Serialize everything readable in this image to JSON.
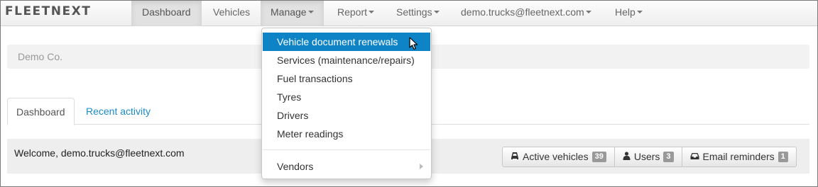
{
  "navbar": {
    "brand": "FLEETNEXT",
    "items": [
      {
        "label": "Dashboard"
      },
      {
        "label": "Vehicles"
      },
      {
        "label": "Manage"
      },
      {
        "label": "Report"
      },
      {
        "label": "Settings"
      },
      {
        "label": "demo.trucks@fleetnext.com"
      },
      {
        "label": "Help"
      }
    ]
  },
  "company": {
    "name": "Demo Co."
  },
  "tabs": [
    {
      "label": "Dashboard"
    },
    {
      "label": "Recent activity"
    }
  ],
  "welcome": {
    "text": "Welcome, demo.trucks@fleetnext.com",
    "buttons": [
      {
        "label": "Active vehicles",
        "count": "39",
        "icon": "truck-icon"
      },
      {
        "label": "Users",
        "count": "3",
        "icon": "user-icon"
      },
      {
        "label": "Email reminders",
        "count": "1",
        "icon": "inbox-icon"
      }
    ]
  },
  "manage_menu": {
    "items": [
      {
        "label": "Vehicle document renewals"
      },
      {
        "label": "Services (maintenance/repairs)"
      },
      {
        "label": "Fuel transactions"
      },
      {
        "label": "Tyres"
      },
      {
        "label": "Drivers"
      },
      {
        "label": "Meter readings"
      },
      {
        "label": "Vendors"
      }
    ]
  },
  "colors": {
    "accent": "#0e84c6",
    "link": "#1d8bc8",
    "badge": "#999999"
  }
}
